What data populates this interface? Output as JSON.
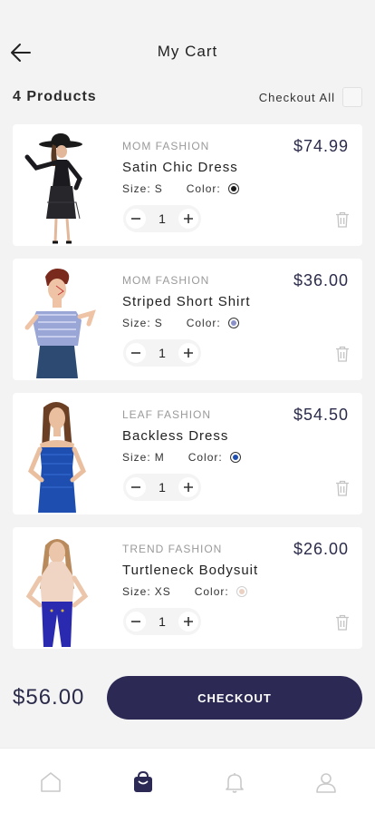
{
  "header": {
    "title": "My Cart",
    "back_icon": "arrow-left-icon"
  },
  "summary": {
    "product_count": "4 Products",
    "checkout_all_label": "Checkout All"
  },
  "items": [
    {
      "brand": "MOM FASHION",
      "name": "Satin Chic Dress",
      "price": "$74.99",
      "size_label": "Size:",
      "size": "S",
      "color_label": "Color:",
      "color": "#1a1a1a",
      "quantity": "1"
    },
    {
      "brand": "MOM FASHION",
      "name": "Striped Short Shirt",
      "price": "$36.00",
      "size_label": "Size:",
      "size": "S",
      "color_label": "Color:",
      "color": "#8a90c8",
      "quantity": "1"
    },
    {
      "brand": "LEAF FASHION",
      "name": "Backless Dress",
      "price": "$54.50",
      "size_label": "Size:",
      "size": "M",
      "color_label": "Color:",
      "color": "#1e4fb0",
      "quantity": "1"
    },
    {
      "brand": "TREND FASHION",
      "name": "Turtleneck Bodysuit",
      "price": "$26.00",
      "size_label": "Size:",
      "size": "XS",
      "color_label": "Color:",
      "color": "#ead1c3",
      "quantity": "1"
    }
  ],
  "footer": {
    "total": "$56.00",
    "checkout_label": "CHECKOUT"
  },
  "tabbar": {
    "icons": [
      "home-icon",
      "shopping-bag-icon",
      "bell-icon",
      "user-icon"
    ],
    "accent": "#2c2a55"
  },
  "colors": {
    "primary": "#2c2a55",
    "background": "#f3f3f3"
  }
}
